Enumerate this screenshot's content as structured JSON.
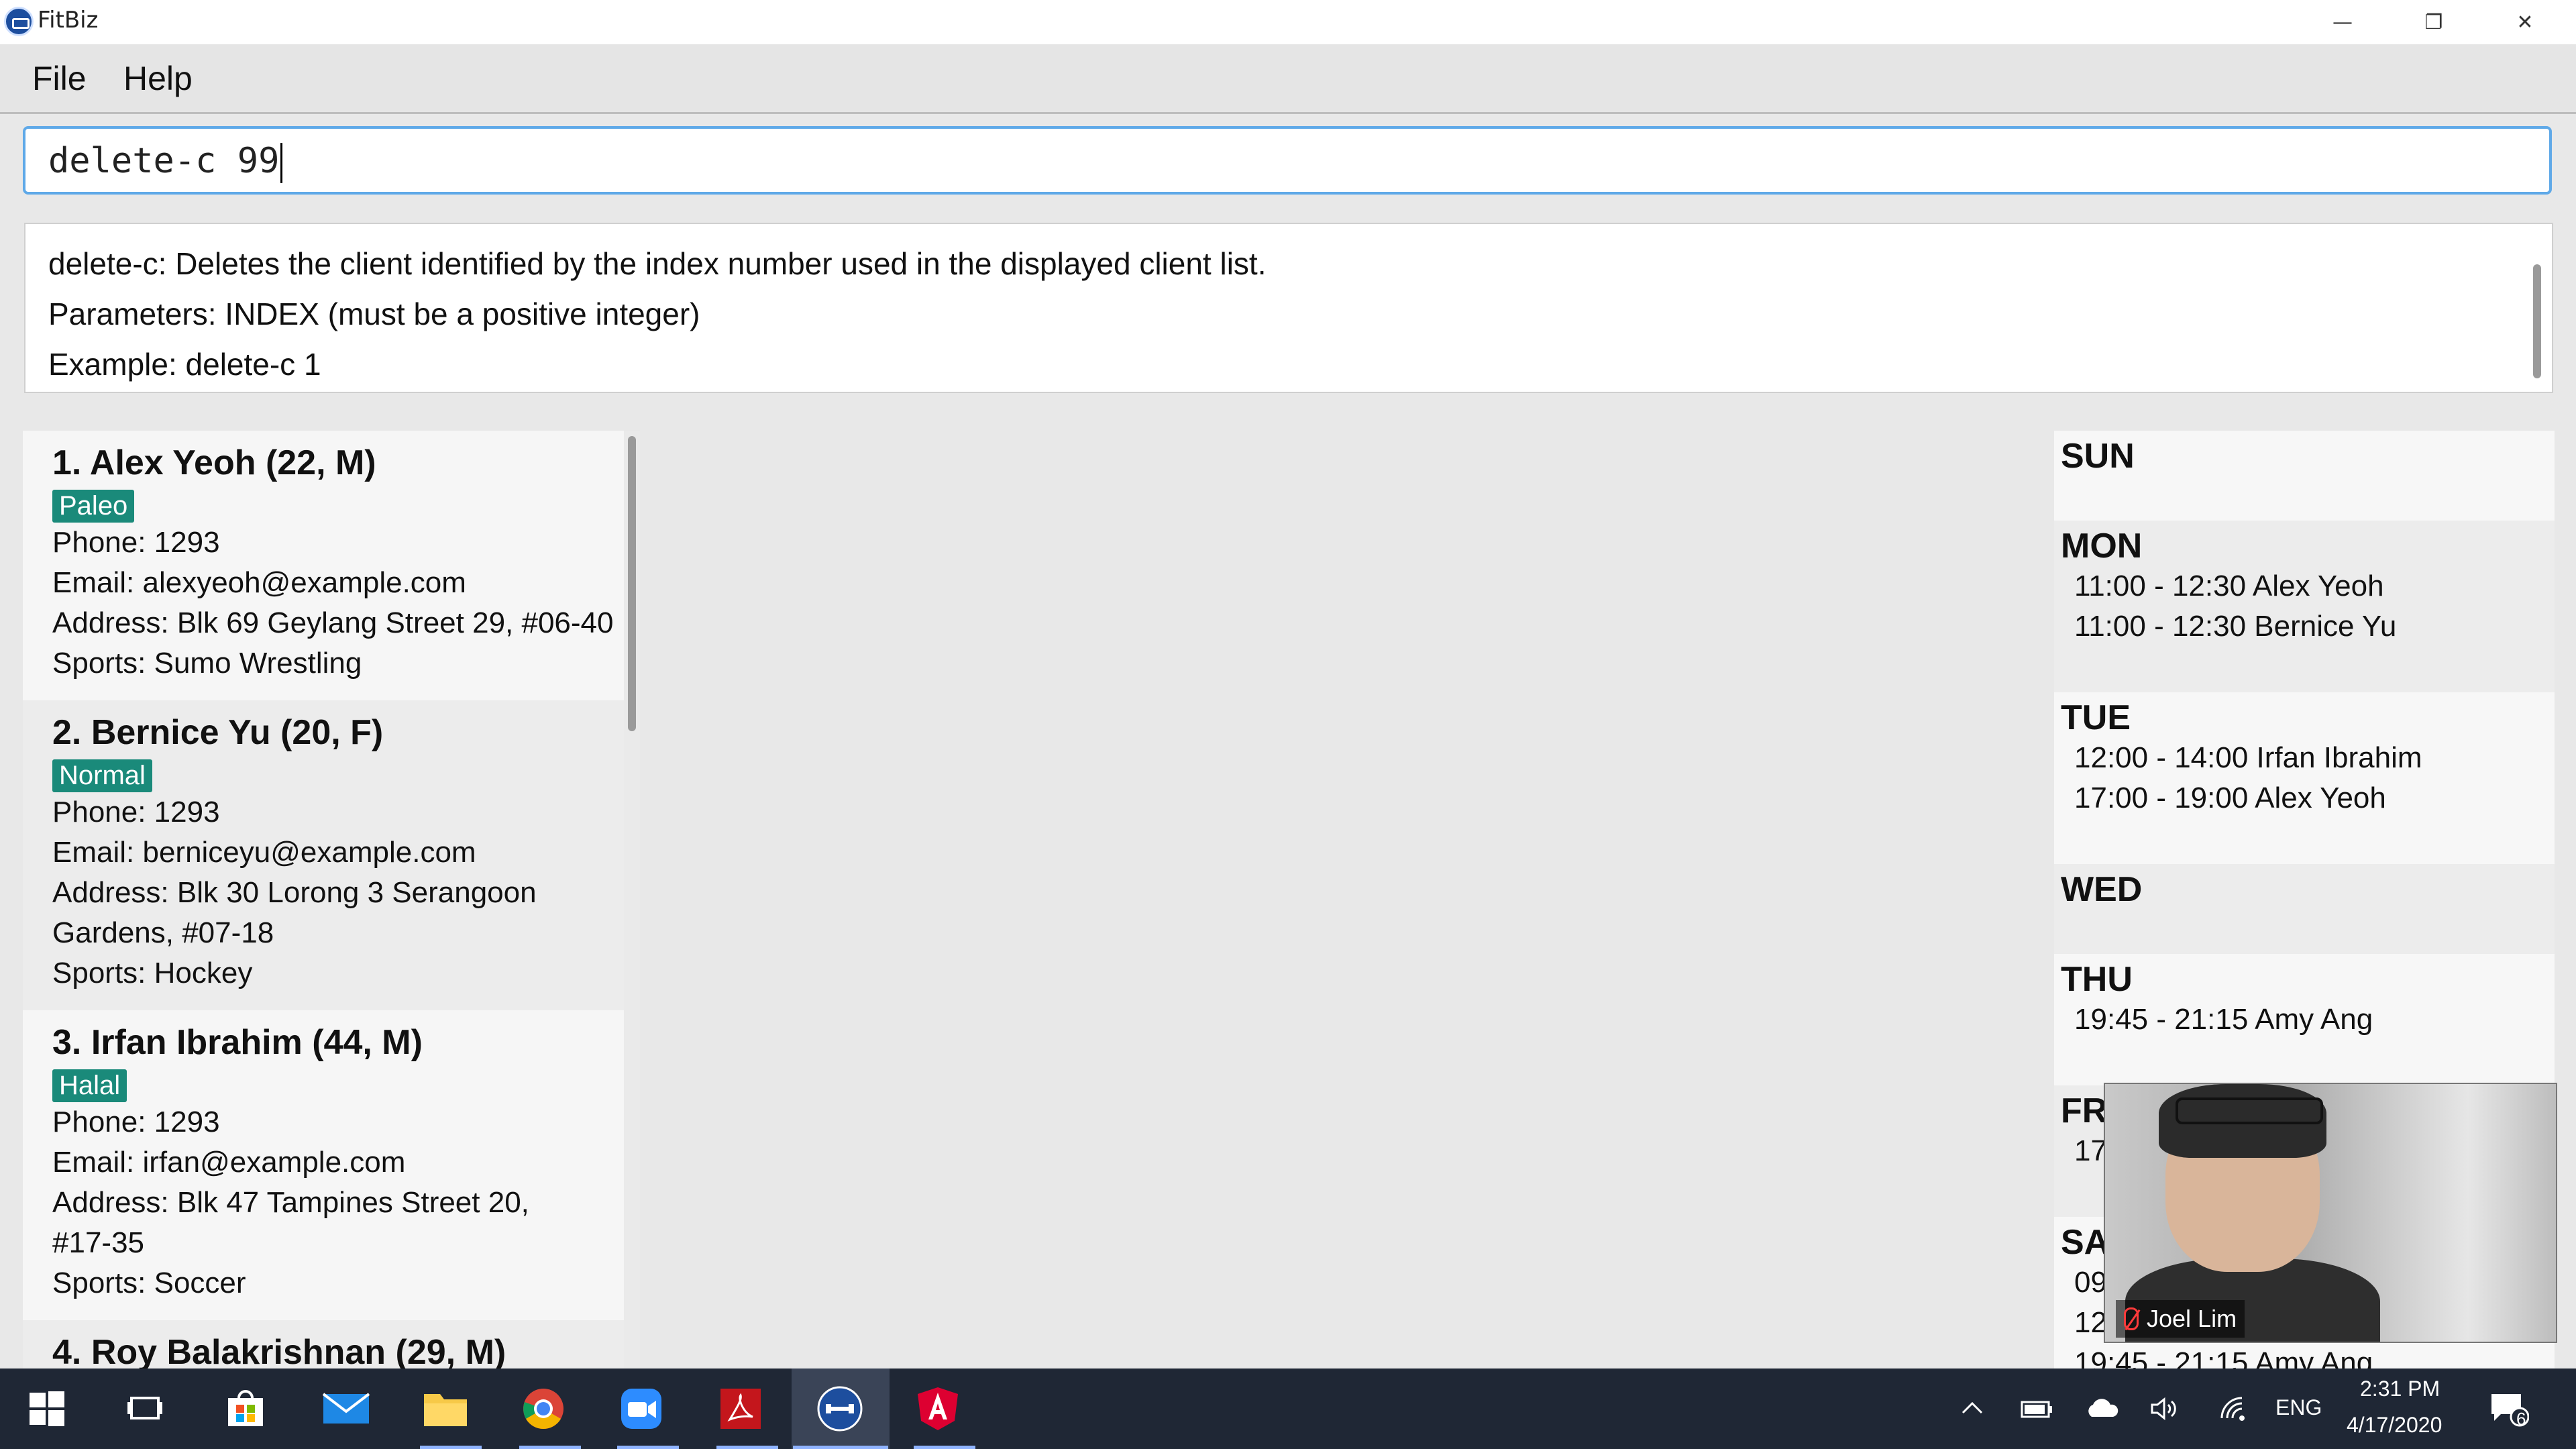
{
  "window": {
    "title": "FitBiz",
    "minimize": "—",
    "restore": "❐",
    "close": "✕"
  },
  "menu": {
    "file": "File",
    "help": "Help"
  },
  "command": {
    "value": "delete-c 99"
  },
  "result": {
    "lines": [
      "delete-c: Deletes the client identified by the index number used in the displayed client list.",
      "Parameters: INDEX (must be a positive integer)",
      "Example: delete-c 1"
    ]
  },
  "clients": [
    {
      "name": "1.  Alex Yeoh (22, M)",
      "tag": "Paleo",
      "lines": [
        "Phone: 1293",
        "Email: alexyeoh@example.com",
        "Address: Blk 69 Geylang Street 29, #06-40",
        "Sports: Sumo Wrestling"
      ]
    },
    {
      "name": "2.  Bernice Yu (20, F)",
      "tag": "Normal",
      "lines": [
        "Phone: 1293",
        "Email: berniceyu@example.com",
        "Address: Blk 30 Lorong 3 Serangoon",
        "Gardens, #07-18",
        "Sports: Hockey"
      ]
    },
    {
      "name": "3.  Irfan Ibrahim (44, M)",
      "tag": "Halal",
      "lines": [
        "Phone: 1293",
        "Email: irfan@example.com",
        "Address: Blk 47 Tampines Street 20,",
        "#17-35",
        "Sports: Soccer"
      ]
    },
    {
      "name": "4.  Roy Balakrishnan (29, M)",
      "tag": "",
      "lines": []
    }
  ],
  "schedule": [
    {
      "day": "SUN",
      "appts": []
    },
    {
      "day": "MON",
      "appts": [
        "11:00 - 12:30 Alex Yeoh",
        "11:00 - 12:30 Bernice Yu"
      ]
    },
    {
      "day": "TUE",
      "appts": [
        "12:00 - 14:00 Irfan Ibrahim",
        "17:00 - 19:00 Alex Yeoh"
      ]
    },
    {
      "day": "WED",
      "appts": []
    },
    {
      "day": "THU",
      "appts": [
        "19:45 - 21:15 Amy Ang"
      ]
    },
    {
      "day": "FR",
      "appts": [
        "17"
      ]
    },
    {
      "day": "SA",
      "appts": [
        "09",
        "12",
        "19:45 - 21:15 Amy Ang"
      ]
    }
  ],
  "video": {
    "participant": "Joel Lim"
  },
  "taskbar": {
    "language": "ENG",
    "time": "2:31 PM",
    "date": "4/17/2020",
    "notifications": "6",
    "colors": {
      "background": "#1f2735",
      "active": "#3a4457"
    }
  },
  "colors": {
    "tag": "#1a8a7a",
    "command_border": "#5fa9e8"
  }
}
